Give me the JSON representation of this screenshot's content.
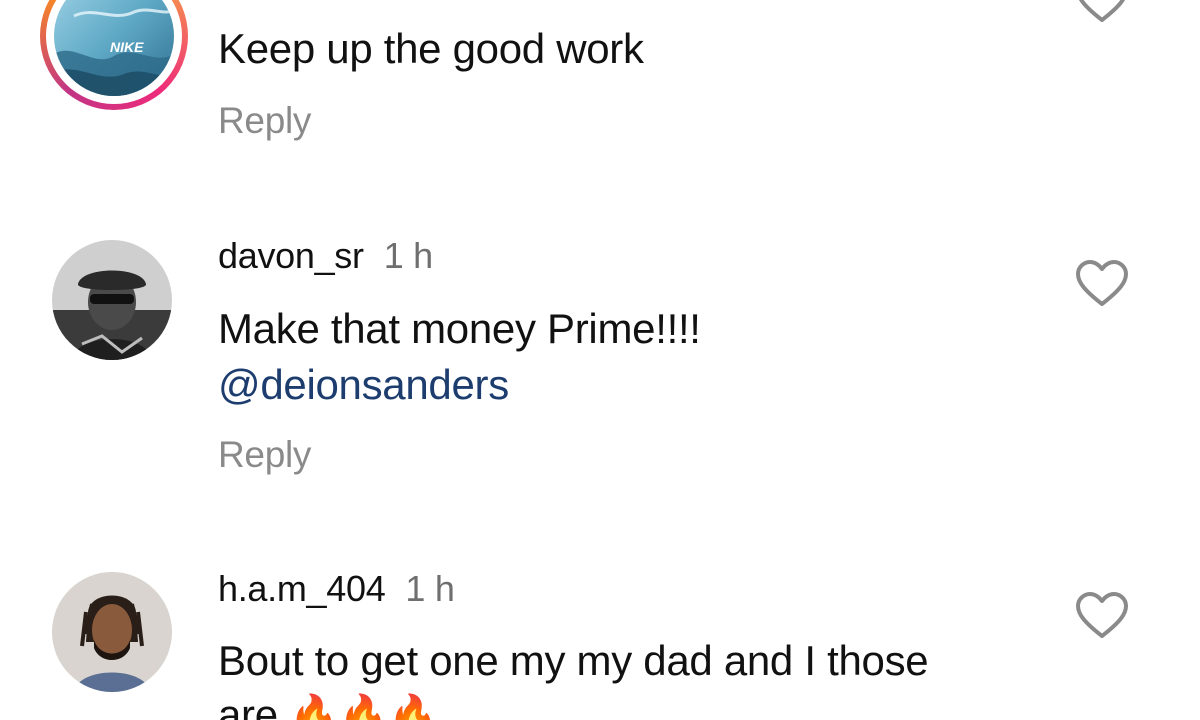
{
  "comments": [
    {
      "username": "",
      "time": "",
      "text": "Keep up the good work",
      "reply_label": "Reply",
      "avatar_text": "NIKE",
      "like_icon": "heart-outline-icon"
    },
    {
      "username": "davon_sr",
      "time": "1 h",
      "text": "Make that money Prime!!!!",
      "mention": "@deionsanders",
      "reply_label": "Reply",
      "like_icon": "heart-outline-icon"
    },
    {
      "username": "h.a.m_404",
      "time": "1 h",
      "text": "Bout to get one my my dad and I those",
      "text_line2": "are",
      "emoji": "🔥🔥🔥",
      "like_icon": "heart-outline-icon"
    }
  ],
  "colors": {
    "text": "#111111",
    "secondary": "#6f6f6f",
    "reply": "#8a8a8a",
    "mention": "#1c3d6e",
    "heart_outline": "#8a8a8a"
  }
}
